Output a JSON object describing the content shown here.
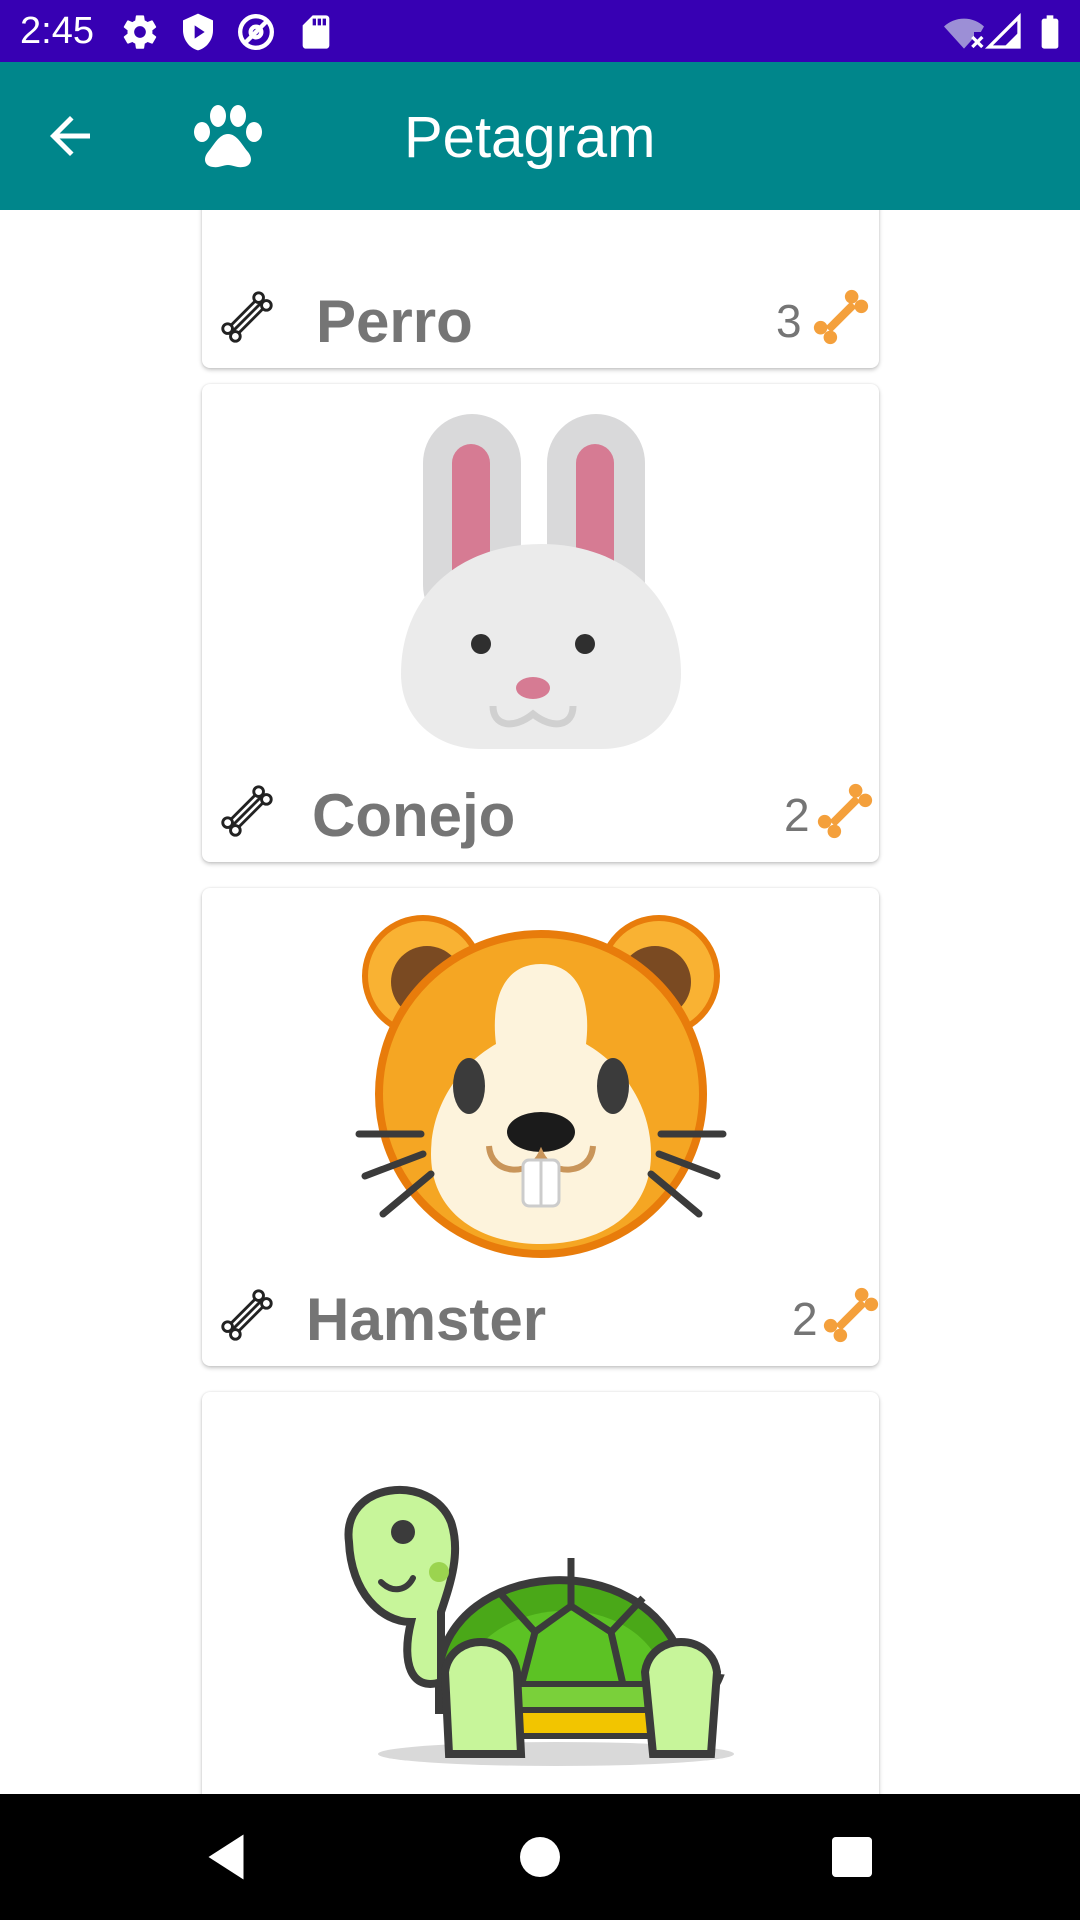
{
  "status_bar": {
    "time": "2:45",
    "left_icons": [
      "settings-icon",
      "play-protect-icon",
      "at-sign-icon",
      "sd-card-icon"
    ],
    "right_icons": [
      "wifi-off-icon",
      "signal-icon",
      "battery-icon"
    ],
    "background": "#3700b3"
  },
  "app_bar": {
    "title": "Petagram",
    "background": "#00868b",
    "icons": [
      "back-arrow-icon",
      "paw-icon"
    ]
  },
  "pets": [
    {
      "name": "Perro",
      "likes": "3",
      "image": "dog-icon"
    },
    {
      "name": "Conejo",
      "likes": "2",
      "image": "rabbit-icon"
    },
    {
      "name": "Hamster",
      "likes": "2",
      "image": "hamster-icon"
    },
    {
      "name": "",
      "likes": "",
      "image": "turtle-icon"
    }
  ],
  "colors": {
    "like_bone": "#f4a03c",
    "text_gray": "#757575"
  },
  "nav_bar": {
    "buttons": [
      "back-nav-icon",
      "home-nav-icon",
      "recents-nav-icon"
    ]
  }
}
